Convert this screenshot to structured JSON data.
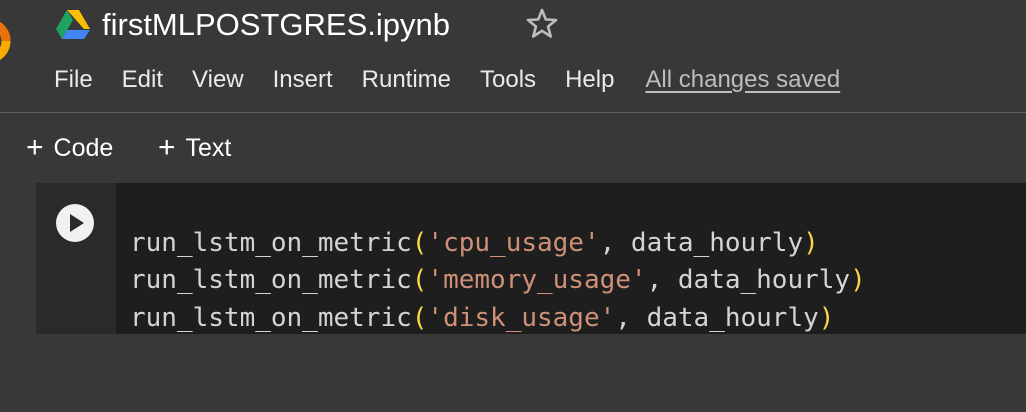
{
  "notebook": {
    "title": "firstMLPOSTGRES.ipynb"
  },
  "menu": {
    "items": [
      "File",
      "Edit",
      "View",
      "Insert",
      "Runtime",
      "Tools",
      "Help"
    ],
    "save_status": "All changes saved"
  },
  "toolbar": {
    "add_code_label": "Code",
    "add_text_label": "Text",
    "plus_glyph": "+"
  },
  "cell": {
    "lines": [
      {
        "fn": "run_lstm_on_metric",
        "open": "(",
        "arg": "'cpu_usage'",
        "sep": ", ",
        "var": "data_hourly",
        "close": ")"
      },
      {
        "fn": "run_lstm_on_metric",
        "open": "(",
        "arg": "'memory_usage'",
        "sep": ", ",
        "var": "data_hourly",
        "close": ")"
      },
      {
        "fn": "run_lstm_on_metric",
        "open": "(",
        "arg": "'disk_usage'",
        "sep": ", ",
        "var": "data_hourly",
        "close": ")"
      }
    ]
  },
  "icons": {
    "logo": "colab-logo-icon",
    "drive": "google-drive-icon",
    "star": "star-icon",
    "run": "play-icon"
  },
  "colors": {
    "background": "#383838",
    "editor_background": "#1e1e1e",
    "string": "#ce9178",
    "bracket": "#f9d849"
  }
}
